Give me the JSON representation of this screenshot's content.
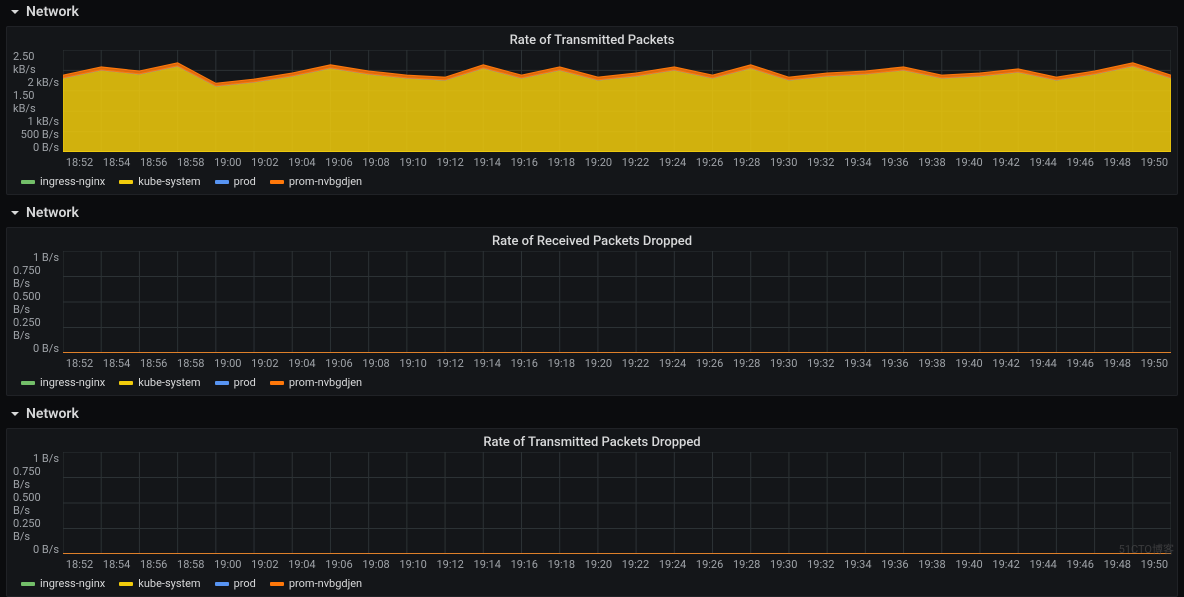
{
  "rows": [
    {
      "title": "Network"
    },
    {
      "title": "Network"
    },
    {
      "title": "Network"
    }
  ],
  "legends": {
    "items": [
      {
        "name": "ingress-nginx",
        "color": "#73BF69"
      },
      {
        "name": "kube-system",
        "color": "#F2CC0C"
      },
      {
        "name": "prod",
        "color": "#5794F2"
      },
      {
        "name": "prom-nvbgdjen",
        "color": "#FF780A"
      }
    ]
  },
  "x_ticks": [
    "18:52",
    "18:54",
    "18:56",
    "18:58",
    "19:00",
    "19:02",
    "19:04",
    "19:06",
    "19:08",
    "19:10",
    "19:12",
    "19:14",
    "19:16",
    "19:18",
    "19:20",
    "19:22",
    "19:24",
    "19:26",
    "19:28",
    "19:30",
    "19:32",
    "19:34",
    "19:36",
    "19:38",
    "19:40",
    "19:42",
    "19:44",
    "19:46",
    "19:48",
    "19:50"
  ],
  "panels": {
    "p0": {
      "title": "Rate of Transmitted Packets",
      "y_ticks": [
        "2.50 kB/s",
        "2 kB/s",
        "1.50 kB/s",
        "1 kB/s",
        "500 B/s",
        "0 B/s"
      ]
    },
    "p1": {
      "title": "Rate of Received Packets Dropped",
      "y_ticks": [
        "1 B/s",
        "0.750 B/s",
        "0.500 B/s",
        "0.250 B/s",
        "0 B/s"
      ]
    },
    "p2": {
      "title": "Rate of Transmitted Packets Dropped",
      "y_ticks": [
        "1 B/s",
        "0.750 B/s",
        "0.500 B/s",
        "0.250 B/s",
        "0 B/s"
      ]
    }
  },
  "watermark": "51CTO博客",
  "chart_data": [
    {
      "type": "area",
      "title": "Rate of Transmitted Packets",
      "xlabel": "",
      "ylabel": "",
      "ylim": [
        0,
        2560
      ],
      "y_ticks_bytes": [
        0,
        512,
        1024,
        1536,
        2048,
        2560
      ],
      "x": [
        "18:52",
        "18:54",
        "18:56",
        "18:58",
        "19:00",
        "19:02",
        "19:04",
        "19:06",
        "19:08",
        "19:10",
        "19:12",
        "19:14",
        "19:16",
        "19:18",
        "19:20",
        "19:22",
        "19:24",
        "19:26",
        "19:28",
        "19:30",
        "19:32",
        "19:34",
        "19:36",
        "19:38",
        "19:40",
        "19:42",
        "19:44",
        "19:46",
        "19:48",
        "19:50"
      ],
      "series": [
        {
          "name": "ingress-nginx",
          "color": "#73BF69",
          "values": [
            5,
            5,
            5,
            5,
            5,
            5,
            5,
            5,
            5,
            5,
            5,
            5,
            5,
            5,
            5,
            5,
            5,
            5,
            5,
            5,
            5,
            5,
            5,
            5,
            5,
            5,
            5,
            5,
            5,
            5
          ]
        },
        {
          "name": "kube-system",
          "color": "#F2CC0C",
          "values": [
            1850,
            2050,
            1950,
            2150,
            1650,
            1750,
            1900,
            2100,
            1950,
            1850,
            1800,
            2100,
            1850,
            2050,
            1800,
            1900,
            2050,
            1850,
            2100,
            1800,
            1900,
            1950,
            2050,
            1850,
            1900,
            2000,
            1800,
            1950,
            2150,
            1850
          ]
        },
        {
          "name": "prod",
          "color": "#5794F2",
          "values": [
            5,
            5,
            5,
            5,
            5,
            5,
            5,
            5,
            5,
            5,
            5,
            5,
            5,
            5,
            5,
            5,
            5,
            5,
            5,
            5,
            5,
            5,
            5,
            5,
            5,
            5,
            5,
            5,
            5,
            5
          ]
        },
        {
          "name": "prom-nvbgdjen",
          "color": "#FF780A",
          "values": [
            70,
            75,
            72,
            80,
            65,
            70,
            72,
            78,
            74,
            70,
            68,
            78,
            70,
            76,
            68,
            72,
            76,
            70,
            78,
            68,
            72,
            74,
            76,
            70,
            72,
            75,
            68,
            74,
            80,
            70
          ]
        }
      ],
      "stacked": true
    },
    {
      "type": "line",
      "title": "Rate of Received Packets Dropped",
      "xlabel": "",
      "ylabel": "",
      "ylim": [
        0,
        1
      ],
      "x": [
        "18:52",
        "18:54",
        "18:56",
        "18:58",
        "19:00",
        "19:02",
        "19:04",
        "19:06",
        "19:08",
        "19:10",
        "19:12",
        "19:14",
        "19:16",
        "19:18",
        "19:20",
        "19:22",
        "19:24",
        "19:26",
        "19:28",
        "19:30",
        "19:32",
        "19:34",
        "19:36",
        "19:38",
        "19:40",
        "19:42",
        "19:44",
        "19:46",
        "19:48",
        "19:50"
      ],
      "series": [
        {
          "name": "ingress-nginx",
          "color": "#73BF69",
          "values": [
            0,
            0,
            0,
            0,
            0,
            0,
            0,
            0,
            0,
            0,
            0,
            0,
            0,
            0,
            0,
            0,
            0,
            0,
            0,
            0,
            0,
            0,
            0,
            0,
            0,
            0,
            0,
            0,
            0,
            0
          ]
        },
        {
          "name": "kube-system",
          "color": "#F2CC0C",
          "values": [
            0,
            0,
            0,
            0,
            0,
            0,
            0,
            0,
            0,
            0,
            0,
            0,
            0,
            0,
            0,
            0,
            0,
            0,
            0,
            0,
            0,
            0,
            0,
            0,
            0,
            0,
            0,
            0,
            0,
            0
          ]
        },
        {
          "name": "prod",
          "color": "#5794F2",
          "values": [
            0,
            0,
            0,
            0,
            0,
            0,
            0,
            0,
            0,
            0,
            0,
            0,
            0,
            0,
            0,
            0,
            0,
            0,
            0,
            0,
            0,
            0,
            0,
            0,
            0,
            0,
            0,
            0,
            0,
            0
          ]
        },
        {
          "name": "prom-nvbgdjen",
          "color": "#FF780A",
          "values": [
            0,
            0,
            0,
            0,
            0,
            0,
            0,
            0,
            0,
            0,
            0,
            0,
            0,
            0,
            0,
            0,
            0,
            0,
            0,
            0,
            0,
            0,
            0,
            0,
            0,
            0,
            0,
            0,
            0,
            0
          ]
        }
      ]
    },
    {
      "type": "line",
      "title": "Rate of Transmitted Packets Dropped",
      "xlabel": "",
      "ylabel": "",
      "ylim": [
        0,
        1
      ],
      "x": [
        "18:52",
        "18:54",
        "18:56",
        "18:58",
        "19:00",
        "19:02",
        "19:04",
        "19:06",
        "19:08",
        "19:10",
        "19:12",
        "19:14",
        "19:16",
        "19:18",
        "19:20",
        "19:22",
        "19:24",
        "19:26",
        "19:28",
        "19:30",
        "19:32",
        "19:34",
        "19:36",
        "19:38",
        "19:40",
        "19:42",
        "19:44",
        "19:46",
        "19:48",
        "19:50"
      ],
      "series": [
        {
          "name": "ingress-nginx",
          "color": "#73BF69",
          "values": [
            0,
            0,
            0,
            0,
            0,
            0,
            0,
            0,
            0,
            0,
            0,
            0,
            0,
            0,
            0,
            0,
            0,
            0,
            0,
            0,
            0,
            0,
            0,
            0,
            0,
            0,
            0,
            0,
            0,
            0
          ]
        },
        {
          "name": "kube-system",
          "color": "#F2CC0C",
          "values": [
            0,
            0,
            0,
            0,
            0,
            0,
            0,
            0,
            0,
            0,
            0,
            0,
            0,
            0,
            0,
            0,
            0,
            0,
            0,
            0,
            0,
            0,
            0,
            0,
            0,
            0,
            0,
            0,
            0,
            0
          ]
        },
        {
          "name": "prod",
          "color": "#5794F2",
          "values": [
            0,
            0,
            0,
            0,
            0,
            0,
            0,
            0,
            0,
            0,
            0,
            0,
            0,
            0,
            0,
            0,
            0,
            0,
            0,
            0,
            0,
            0,
            0,
            0,
            0,
            0,
            0,
            0,
            0,
            0
          ]
        },
        {
          "name": "prom-nvbgdjen",
          "color": "#FF780A",
          "values": [
            0,
            0,
            0,
            0,
            0,
            0,
            0,
            0,
            0,
            0,
            0,
            0,
            0,
            0,
            0,
            0,
            0,
            0,
            0,
            0,
            0,
            0,
            0,
            0,
            0,
            0,
            0,
            0,
            0,
            0
          ]
        }
      ]
    }
  ]
}
